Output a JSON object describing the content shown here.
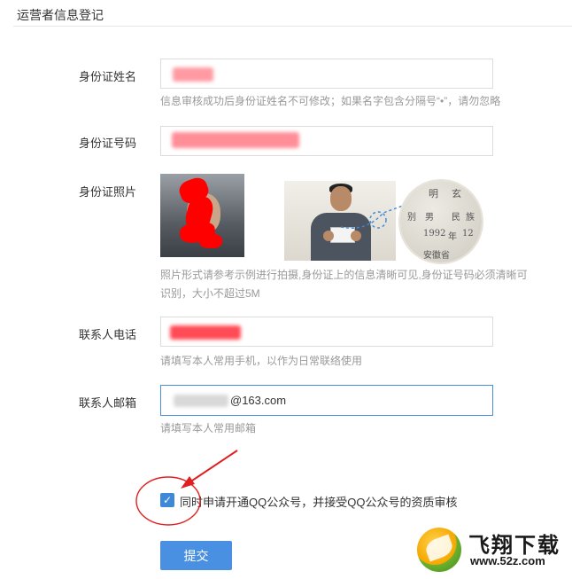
{
  "section": {
    "title": "运营者信息登记"
  },
  "form": {
    "id_name": {
      "label": "身份证姓名",
      "hint": "信息审核成功后身份证姓名不可修改；如果名字包含分隔号“•”，请勿忽略"
    },
    "id_number": {
      "label": "身份证号码"
    },
    "id_photo": {
      "label": "身份证照片",
      "hint_line1": "照片形式请参考示例进行拍摄,身份证上的信息清晰可见,身份证号码必须清晰可",
      "hint_line2": "识别，大小不超过5M",
      "sample_zoom_text": [
        "明",
        "玄",
        "别",
        "男",
        "民",
        "族",
        "1992",
        "年",
        "12",
        "安徽省",
        "出"
      ]
    },
    "contact_phone": {
      "label": "联系人电话",
      "hint": "请填写本人常用手机，以作为日常联络使用"
    },
    "contact_email": {
      "label": "联系人邮箱",
      "visible_value": "@163.com",
      "hint": "请填写本人常用邮箱"
    },
    "agreement": {
      "checked": true,
      "label": "同时申请开通QQ公众号，并接受QQ公众号的资质审核"
    },
    "submit_label": "提交"
  },
  "watermark": {
    "name": "飞翔下载",
    "url": "www.52z.com"
  },
  "colors": {
    "accent": "#4a90e2",
    "checkbox": "#3d88d9",
    "redaction": "#ff3b3b",
    "annotation": "#e02020"
  },
  "icons": {
    "checkbox": "check-icon",
    "annotation_arrow": "arrow-icon",
    "annotation_circle": "circle-highlight"
  }
}
